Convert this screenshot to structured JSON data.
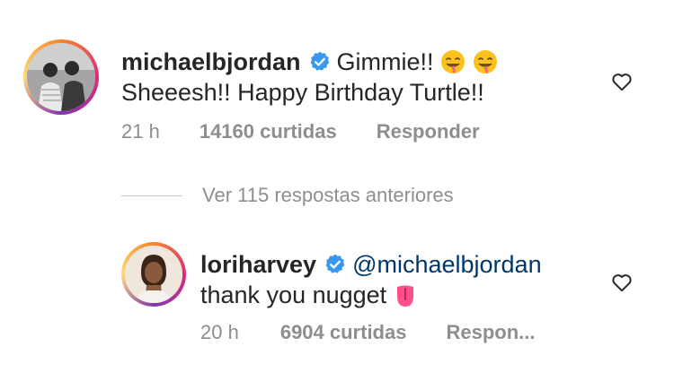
{
  "comments": [
    {
      "username": "michaelbjordan",
      "verified": true,
      "text_line1": "Gimmie!!",
      "text_line2": "Sheeesh!! Happy Birthday Turtle!!",
      "emojis": [
        "drooling-face",
        "drooling-face"
      ],
      "time": "21 h",
      "likes": "14160 curtidas",
      "reply": "Responder"
    },
    {
      "username": "loriharvey",
      "verified": true,
      "mention": "@michaelbjordan",
      "text_line2": "thank you nugget",
      "emojis": [
        "tongue"
      ],
      "time": "20 h",
      "likes": "6904 curtidas",
      "reply": "Respon..."
    }
  ],
  "view_replies": "Ver 115 respostas anteriores",
  "icons": {
    "heart": "heart-outline-icon",
    "verified": "verified-badge-icon"
  },
  "colors": {
    "text": "#262626",
    "meta": "#8e8e8e",
    "mention": "#00376b",
    "verified": "#3897f0"
  }
}
